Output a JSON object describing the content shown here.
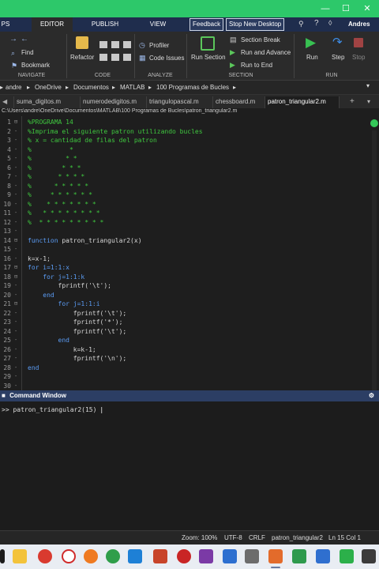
{
  "ribbon_tabs": [
    "PS",
    "EDITOR",
    "PUBLISH",
    "VIEW"
  ],
  "header_buttons": {
    "feedback": "Feedback",
    "stop_desktop": "Stop New Desktop",
    "user": "Andres"
  },
  "navigate": {
    "find": "Find",
    "bookmark": "Bookmark",
    "section": "NAVIGATE"
  },
  "code": {
    "refactor": "Refactor",
    "section": "CODE"
  },
  "analyze": {
    "profiler": "Profiler",
    "code_issues": "Code Issues",
    "section": "ANALYZE"
  },
  "section_grp": {
    "run_section": "Run Section",
    "section_break": "Section Break",
    "run_advance": "Run and Advance",
    "run_end": "Run to End",
    "section": "SECTION"
  },
  "run": {
    "run": "Run",
    "step": "Step",
    "stop": "Stop",
    "section": "RUN"
  },
  "breadcrumb": [
    "andre",
    "OneDrive",
    "Documentos",
    "MATLAB",
    "100 Programas de Bucles"
  ],
  "file_tabs": [
    "suma_digitos.m",
    "numerodedigitos.m",
    "triangulopascal.m",
    "chessboard.m",
    "patron_triangular2.m"
  ],
  "path": "C:\\Users\\andre\\OneDrive\\Documentos\\MATLAB\\100 Programas de Bucles\\patron_triangular2.m",
  "editor_lines": [
    {
      "n": "1",
      "t": "%PROGRAMA 14",
      "k": "c"
    },
    {
      "n": "2",
      "t": "%Imprima el siguiente patron utilizando bucles",
      "k": "c"
    },
    {
      "n": "3",
      "t": "% x = cantidad de filas del patron",
      "k": "c"
    },
    {
      "n": "4",
      "t": "%          *",
      "k": "c"
    },
    {
      "n": "5",
      "t": "%         * *",
      "k": "c"
    },
    {
      "n": "6",
      "t": "%        * * *",
      "k": "c"
    },
    {
      "n": "7",
      "t": "%       * * * *",
      "k": "c"
    },
    {
      "n": "8",
      "t": "%      * * * * *",
      "k": "c"
    },
    {
      "n": "9",
      "t": "%     * * * * * *",
      "k": "c"
    },
    {
      "n": "10",
      "t": "%    * * * * * * *",
      "k": "c"
    },
    {
      "n": "11",
      "t": "%   * * * * * * * *",
      "k": "c"
    },
    {
      "n": "12",
      "t": "%  * * * * * * * * *",
      "k": "c"
    },
    {
      "n": "13",
      "t": "",
      "k": "d"
    },
    {
      "n": "14",
      "t": "function patron_triangular2(x)",
      "k": "f"
    },
    {
      "n": "15",
      "t": "",
      "k": "d"
    },
    {
      "n": "16",
      "t": "k=x-1;",
      "k": "d"
    },
    {
      "n": "17",
      "t": "for i=1:1:x",
      "k": "kw"
    },
    {
      "n": "18",
      "t": "    for j=1:1:k",
      "k": "kw"
    },
    {
      "n": "19",
      "t": "        fprintf('\\t');",
      "k": "d"
    },
    {
      "n": "20",
      "t": "    end",
      "k": "kw"
    },
    {
      "n": "21",
      "t": "        for j=1:1:i",
      "k": "kw"
    },
    {
      "n": "22",
      "t": "            fprintf('\\t');",
      "k": "d"
    },
    {
      "n": "23",
      "t": "            fprintf('*');",
      "k": "d"
    },
    {
      "n": "24",
      "t": "            fprintf('\\t');",
      "k": "d"
    },
    {
      "n": "25",
      "t": "        end",
      "k": "kw"
    },
    {
      "n": "26",
      "t": "            k=k-1;",
      "k": "d"
    },
    {
      "n": "27",
      "t": "            fprintf('\\n');",
      "k": "d"
    },
    {
      "n": "28",
      "t": "end",
      "k": "kw"
    },
    {
      "n": "29",
      "t": "",
      "k": "d"
    },
    {
      "n": "30",
      "t": "",
      "k": "d"
    }
  ],
  "command_window": {
    "title": "Command Window",
    "prompt": ">> ",
    "input": "patron_triangular2(15)"
  },
  "status_bar": {
    "zoom": "Zoom: 100%",
    "encoding": "UTF-8",
    "eol": "CRLF",
    "file": "patron_triangular2",
    "pos": "Ln 15 Col 1"
  },
  "colors": {
    "titlebar": "#2dc86a",
    "tabrow": "#1f2d4d",
    "comment": "#3fc73f",
    "keyword": "#5b9cf4"
  }
}
